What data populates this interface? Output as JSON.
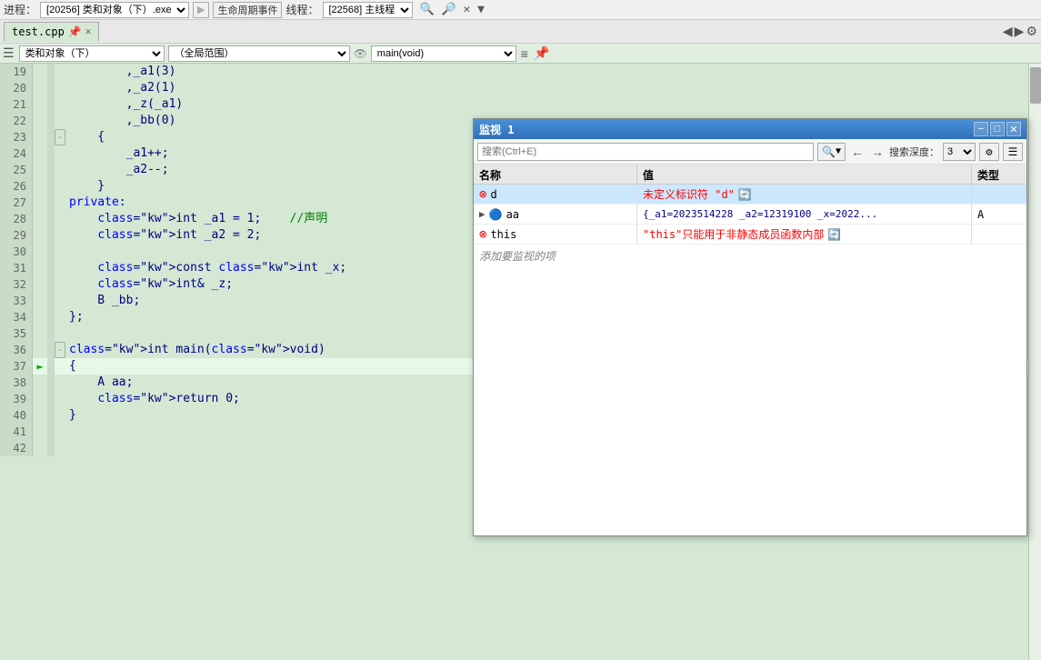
{
  "toolbar": {
    "process_label": "进程：",
    "process_value": "[20256] 类和对象（下）.exe",
    "lifecycle_label": "生命周期事件",
    "thread_label": "线程：",
    "thread_value": "[22568] 主线程"
  },
  "tabs": [
    {
      "label": "test.cpp",
      "pinned": true,
      "active": true
    }
  ],
  "code_header": {
    "class_select": "类和对象（下）",
    "scope_select": "（全局范围）",
    "func_select": "main(void)"
  },
  "code_lines": [
    {
      "num": 19,
      "content": "        ,_a1(3)",
      "fold": "",
      "arrow": ""
    },
    {
      "num": 20,
      "content": "        ,_a2(1)",
      "fold": "",
      "arrow": ""
    },
    {
      "num": 21,
      "content": "        ,_z(_a1)",
      "fold": "",
      "arrow": ""
    },
    {
      "num": 22,
      "content": "        ,_bb(0)",
      "fold": "",
      "arrow": ""
    },
    {
      "num": 23,
      "content": "    {",
      "fold": "-",
      "arrow": ""
    },
    {
      "num": 24,
      "content": "        _a1++;",
      "fold": "",
      "arrow": ""
    },
    {
      "num": 25,
      "content": "        _a2--;",
      "fold": "",
      "arrow": ""
    },
    {
      "num": 26,
      "content": "    }",
      "fold": "",
      "arrow": ""
    },
    {
      "num": 27,
      "content": "private:",
      "fold": "",
      "arrow": ""
    },
    {
      "num": 28,
      "content": "    int _a1 = 1;    //声明",
      "fold": "",
      "arrow": ""
    },
    {
      "num": 29,
      "content": "    int _a2 = 2;",
      "fold": "",
      "arrow": ""
    },
    {
      "num": 30,
      "content": "",
      "fold": "",
      "arrow": ""
    },
    {
      "num": 31,
      "content": "    const int _x;",
      "fold": "",
      "arrow": ""
    },
    {
      "num": 32,
      "content": "    int& _z;",
      "fold": "",
      "arrow": ""
    },
    {
      "num": 33,
      "content": "    B _bb;",
      "fold": "",
      "arrow": ""
    },
    {
      "num": 34,
      "content": "};",
      "fold": "",
      "arrow": ""
    },
    {
      "num": 35,
      "content": "",
      "fold": "",
      "arrow": ""
    },
    {
      "num": 36,
      "content": "int main(void)",
      "fold": "-",
      "arrow": "",
      "is_int_main": true
    },
    {
      "num": 37,
      "content": "{",
      "fold": "",
      "arrow": "►",
      "highlighted": true
    },
    {
      "num": 38,
      "content": "    A aa;",
      "fold": "",
      "arrow": ""
    },
    {
      "num": 39,
      "content": "    return 0;",
      "fold": "",
      "arrow": ""
    },
    {
      "num": 40,
      "content": "}",
      "fold": "",
      "arrow": ""
    },
    {
      "num": 41,
      "content": "",
      "fold": "",
      "arrow": ""
    },
    {
      "num": 42,
      "content": "",
      "fold": "",
      "arrow": ""
    }
  ],
  "watch_window": {
    "title": "监视 1",
    "search_placeholder": "搜索(Ctrl+E)",
    "nav_back": "←",
    "nav_forward": "→",
    "depth_label": "搜索深度：",
    "depth_value": "3",
    "columns": {
      "name": "名称",
      "value": "值",
      "type": "类型"
    },
    "rows": [
      {
        "id": "d",
        "name": "d",
        "value": "未定义标识符 \"d\"",
        "type": "",
        "status": "error",
        "has_refresh": true,
        "selected": true
      },
      {
        "id": "aa",
        "name": "aa",
        "value": "{_a1=2023514228 _a2=12319100 _x=2022...",
        "type": "A",
        "status": "info",
        "expandable": true,
        "has_refresh": false,
        "selected": false
      },
      {
        "id": "this",
        "name": "this",
        "value": "\"this\"只能用于非静态成员函数内部",
        "type": "",
        "status": "error",
        "has_refresh": true,
        "selected": false
      }
    ],
    "add_watch_text": "添加要监视的项",
    "btn_minus": "−",
    "btn_restore": "□",
    "btn_close": "✕"
  }
}
